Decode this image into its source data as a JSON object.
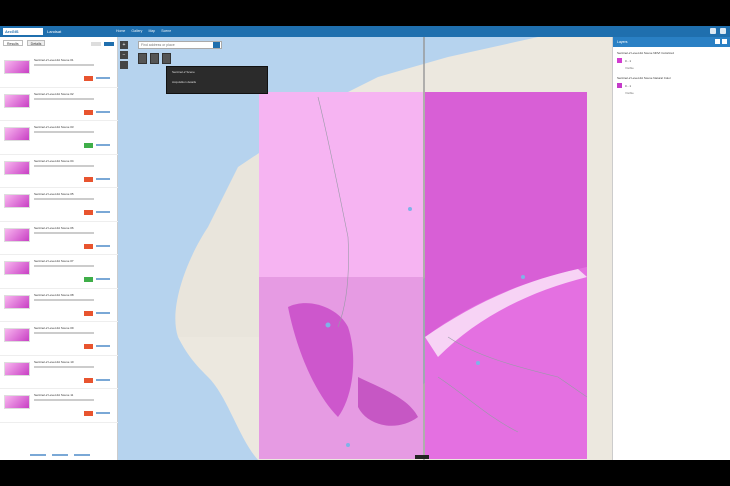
{
  "app": {
    "logo": "ArcGIS",
    "title": "Landsat",
    "nav": [
      "Home",
      "Gallery",
      "Map",
      "Scene"
    ]
  },
  "left_panel": {
    "tabs": [
      "Results",
      "Details"
    ],
    "rows": [
      {
        "title": "Sentinel-2 Level-2A Scene 01",
        "badge": "orange"
      },
      {
        "title": "Sentinel-2 Level-2A Scene 02",
        "badge": "orange"
      },
      {
        "title": "Sentinel-2 Level-2A Scene 03",
        "badge": "green"
      },
      {
        "title": "Sentinel-2 Level-2A Scene 04",
        "badge": "orange"
      },
      {
        "title": "Sentinel-2 Level-2A Scene 05",
        "badge": "orange"
      },
      {
        "title": "Sentinel-2 Level-2A Scene 06",
        "badge": "orange"
      },
      {
        "title": "Sentinel-2 Level-2A Scene 07",
        "badge": "green"
      },
      {
        "title": "Sentinel-2 Level-2A Scene 08",
        "badge": "orange"
      },
      {
        "title": "Sentinel-2 Level-2A Scene 09",
        "badge": "orange"
      },
      {
        "title": "Sentinel-2 Level-2A Scene 10",
        "badge": "orange"
      },
      {
        "title": "Sentinel-2 Level-2A Scene 11",
        "badge": "orange"
      }
    ]
  },
  "map": {
    "search_placeholder": "Find address or place",
    "popup_title": "Sentinel-2 Scene",
    "popup_body": "Acquisition details",
    "zoom_in": "+",
    "zoom_out": "−"
  },
  "right_panel": {
    "title": "Layers",
    "layers": [
      {
        "title": "Sentinel-2 Level-2A Scene NDVI Colorized",
        "swatch": "#d23cd0",
        "label": "0 - 1",
        "sub": "Visible"
      },
      {
        "title": "Sentinel-2 Level-2A Scene Natural Color",
        "swatch": "#c53bc9",
        "label": "0 - 1",
        "sub": "Visible"
      }
    ]
  },
  "colors": {
    "accent": "#1f6fae",
    "overlay_light": "#f7b1f3",
    "overlay_dark": "#d248d2"
  }
}
